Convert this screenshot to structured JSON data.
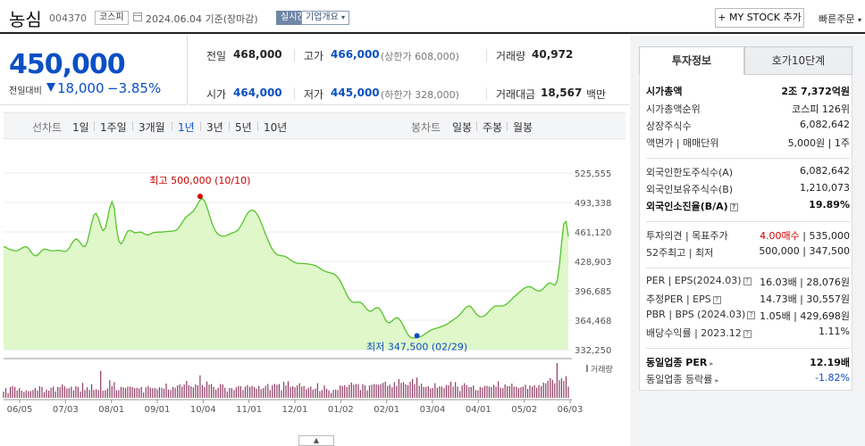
{
  "header": {
    "stock_name": "농심",
    "stock_code": "004370",
    "market_badge": "코스피",
    "date": "2024.06.04 기준(장마감)",
    "realtime_badge": "실시간",
    "company_info_badge": "기업개요",
    "my_stock_button": "+ MY STOCK 추가",
    "quick_order": "빠른주문"
  },
  "price": {
    "current": "450,000",
    "diff_label": "전일대비",
    "diff": "18,000",
    "pct": "−3.85%"
  },
  "quotes": {
    "prev_label": "전일",
    "prev_value": "468,000",
    "high_label": "고가",
    "high_value": "466,000",
    "upper_limit": "(상한가 608,000)",
    "volume_label": "거래량",
    "volume_value": "40,972",
    "open_label": "시가",
    "open_value": "464,000",
    "low_label": "저가",
    "low_value": "445,000",
    "lower_limit": "(하한가 328,000)",
    "amount_label": "거래대금",
    "amount_value": "18,567",
    "amount_unit": "백만"
  },
  "chart_tabs": {
    "line_label": "선차트",
    "line_ranges": [
      "1일",
      "1주일",
      "3개월",
      "1년",
      "3년",
      "5년",
      "10년"
    ],
    "active_range": "1년",
    "candle_label": "봉차트",
    "candle_ranges": [
      "일봉",
      "주봉",
      "월봉"
    ]
  },
  "chart_data": {
    "type": "area",
    "yticks": [
      "525,555",
      "493,338",
      "461,120",
      "428,903",
      "396,685",
      "364,468",
      "332,250"
    ],
    "ylim": [
      332250,
      525555
    ],
    "xticks": [
      "06/05",
      "07/03",
      "08/01",
      "09/01",
      "10/04",
      "11/01",
      "12/01",
      "01/02",
      "02/01",
      "03/04",
      "04/01",
      "05/02",
      "06/03"
    ],
    "high_annotation": "최고 500,000 (10/10)",
    "low_annotation": "최저 347,500 (02/29)",
    "high_point": {
      "index": 87,
      "value": 500000
    },
    "low_point": {
      "index": 183,
      "value": 347500
    },
    "volume_label": "거래량",
    "prices": [
      445000,
      444200,
      442800,
      441700,
      441000,
      440500,
      440600,
      441500,
      443300,
      444600,
      445000,
      443300,
      439800,
      436600,
      435000,
      435700,
      438200,
      441000,
      442400,
      442000,
      441000,
      440500,
      440500,
      440700,
      441000,
      440800,
      440200,
      439700,
      440400,
      443200,
      447600,
      451400,
      453500,
      452300,
      449000,
      445700,
      445000,
      449800,
      460000,
      471100,
      479500,
      481400,
      475800,
      467700,
      462700,
      465000,
      475300,
      487600,
      494300,
      487300,
      465000,
      451500,
      447900,
      451400,
      457700,
      462000,
      462800,
      461700,
      460000,
      460400,
      461000,
      460800,
      459500,
      458300,
      457900,
      458800,
      460000,
      460600,
      460800,
      460900,
      461000,
      461200,
      461500,
      461700,
      461900,
      462100,
      462500,
      464200,
      467300,
      471200,
      475000,
      477900,
      479900,
      481700,
      484000,
      487700,
      492300,
      496100,
      497500,
      494900,
      488600,
      480500,
      472500,
      466000,
      461300,
      458500,
      457000,
      456300,
      456600,
      457500,
      458700,
      459800,
      460600,
      461700,
      463900,
      467700,
      472400,
      477200,
      481400,
      484100,
      485200,
      484200,
      481400,
      477000,
      471300,
      465000,
      458600,
      452400,
      446800,
      442100,
      438600,
      436400,
      435400,
      435100,
      434800,
      433900,
      432300,
      430400,
      428800,
      427600,
      426900,
      426600,
      426600,
      426500,
      426300,
      426000,
      425600,
      425000,
      424100,
      422900,
      421400,
      419800,
      418500,
      417500,
      416800,
      416100,
      415300,
      413800,
      411300,
      407600,
      402700,
      397300,
      392100,
      387800,
      385000,
      384000,
      384200,
      384500,
      384000,
      382000,
      379000,
      376000,
      374300,
      374700,
      376500,
      378200,
      378000,
      375100,
      370300,
      365300,
      362000,
      361700,
      363600,
      366100,
      367400,
      366200,
      362900,
      358300,
      353100,
      348800,
      346000,
      345000,
      345100,
      345600,
      346100,
      347000,
      348500,
      350300,
      352000,
      353400,
      354500,
      355300,
      356100,
      356800,
      357600,
      358600,
      359800,
      361300,
      363000,
      364800,
      366500,
      368300,
      370600,
      373600,
      376700,
      379200,
      380100,
      378800,
      375700,
      372100,
      369500,
      368300,
      368400,
      369700,
      371800,
      374400,
      377100,
      379200,
      380100,
      380100,
      380000,
      380200,
      381100,
      382800,
      385100,
      387600,
      390000,
      392300,
      394400,
      396500,
      398500,
      400200,
      401200,
      401100,
      400100,
      398500,
      397000,
      396400,
      397200,
      399400,
      402100,
      404500,
      405300,
      404100,
      402700,
      406900,
      423600,
      448500,
      470000,
      472400,
      456000
    ],
    "volumes": [
      0.17,
      0.26,
      0.13,
      0.29,
      0.32,
      0.29,
      0.2,
      0.26,
      0.19,
      0.16,
      0.2,
      0.18,
      0.18,
      0.21,
      0.26,
      0.19,
      0.31,
      0.29,
      0.15,
      0.22,
      0.19,
      0.27,
      0.3,
      0.17,
      0.29,
      0.28,
      0.36,
      0.31,
      0.25,
      0.26,
      0.3,
      0.2,
      0.31,
      0.29,
      0.17,
      0.4,
      0.21,
      0.28,
      0.21,
      0.36,
      0.21,
      0.23,
      0.21,
      0.72,
      0.19,
      0.2,
      0.25,
      0.47,
      0.31,
      0.42,
      0.2,
      0.21,
      0.29,
      0.28,
      0.26,
      0.3,
      0.3,
      0.29,
      0.26,
      0.27,
      0.25,
      0.29,
      0.14,
      0.28,
      0.32,
      0.27,
      0.26,
      0.26,
      0.23,
      0.28,
      0.27,
      0.24,
      0.38,
      0.22,
      0.21,
      0.29,
      0.27,
      0.33,
      0.36,
      0.3,
      0.36,
      0.45,
      0.34,
      0.31,
      0.28,
      0.36,
      0.33,
      0.6,
      0.34,
      0.29,
      0.43,
      0.35,
      0.37,
      0.29,
      0.22,
      0.27,
      0.37,
      0.36,
      0.27,
      0.17,
      0.26,
      0.26,
      0.21,
      0.28,
      0.32,
      0.31,
      0.21,
      0.3,
      0.34,
      0.29,
      0.32,
      0.29,
      0.24,
      0.32,
      0.23,
      0.26,
      0.32,
      0.37,
      0.21,
      0.34,
      0.37,
      0.35,
      0.37,
      0.2,
      0.43,
      0.33,
      0.44,
      0.29,
      0.31,
      0.28,
      0.33,
      0.39,
      0.3,
      0.32,
      0.23,
      0.27,
      0.3,
      0.22,
      0.25,
      0.39,
      0.18,
      0.21,
      0.33,
      0.24,
      0.2,
      0.13,
      0.21,
      0.22,
      0.21,
      0.33,
      0.32,
      0.34,
      0.29,
      0.35,
      0.41,
      0.35,
      0.37,
      0.37,
      0.21,
      0.37,
      0.33,
      0.2,
      0.33,
      0.35,
      0.37,
      0.36,
      0.35,
      0.37,
      0.4,
      0.43,
      0.32,
      0.35,
      0.28,
      0.42,
      0.32,
      0.5,
      0.4,
      0.42,
      0.36,
      0.34,
      0.43,
      0.5,
      0.37,
      0.54,
      0.32,
      0.38,
      0.29,
      0.29,
      0.31,
      0.25,
      0.26,
      0.39,
      0.27,
      0.31,
      0.3,
      0.26,
      0.34,
      0.33,
      0.43,
      0.3,
      0.42,
      0.3,
      0.18,
      0.33,
      0.39,
      0.34,
      0.29,
      0.29,
      0.33,
      0.21,
      0.2,
      0.29,
      0.27,
      0.32,
      0.32,
      0.3,
      0.29,
      0.35,
      0.3,
      0.44,
      0.27,
      0.26,
      0.36,
      0.31,
      0.32,
      0.38,
      0.3,
      0.3,
      0.26,
      0.28,
      0.3,
      0.35,
      0.24,
      0.33,
      0.3,
      0.34,
      0.27,
      0.34,
      0.31,
      0.41,
      0.39,
      0.46,
      0.53,
      0.48,
      0.39,
      0.93,
      0.47,
      0.52,
      0.45,
      0.58,
      0.3
    ]
  },
  "invest": {
    "tab_active": "투자정보",
    "tab_other": "호가10단계",
    "rows1": [
      {
        "label": "시가총액",
        "value": "2조 7,372억원",
        "strong": true
      },
      {
        "label": "시가총액순위",
        "value": "코스피 126위"
      },
      {
        "label": "상장주식수",
        "value": "6,082,642"
      },
      {
        "label": "액면가 | 매매단위",
        "value": "5,000원 | 1주"
      }
    ],
    "rows2": [
      {
        "label": "외국인한도주식수(A)",
        "value": "6,082,642"
      },
      {
        "label": "외국인보유주식수(B)",
        "value": "1,210,073"
      },
      {
        "label": "외국인소진율(B/A)",
        "value": "19.89%",
        "strong": true
      }
    ],
    "opinion_label": "투자의견 | 목표주가",
    "opinion_value": "4.00매수",
    "target_value": "| 535,000",
    "week52_label": "52주최고 | 최저",
    "week52_value": "500,000 | 347,500",
    "rows3": [
      {
        "label": "PER | EPS(2024.03)",
        "value": "16.03배 | 28,076원"
      },
      {
        "label": "추정PER | EPS",
        "value": "14.73배 | 30,557원"
      },
      {
        "label": "PBR | BPS (2024.03)",
        "value": "1.05배 | 429,698원"
      },
      {
        "label": "배당수익률 | 2023.12",
        "value": "1.11%"
      }
    ],
    "sector_per_label": "동일업종 PER",
    "sector_per_value": "12.19배",
    "sector_rate_label": "동일업종 등락률",
    "sector_rate_value": "-1.82%"
  },
  "colors": {
    "down_blue": "#0a4fc4",
    "up_red": "#d30000",
    "line_green": "#55c42b",
    "area_fill": "#dff7c9"
  }
}
